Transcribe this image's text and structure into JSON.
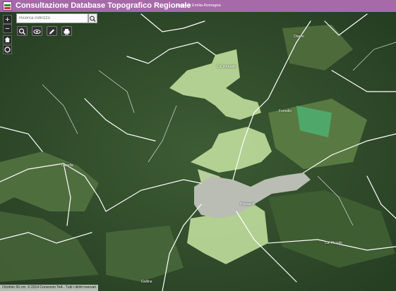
{
  "header": {
    "title": "Consultazione Database Topografico Regionale",
    "subtitle": "Regione Emilia-Romagna",
    "colors": {
      "header_bg": "#a66aa9"
    }
  },
  "search": {
    "placeholder": "Ricerca indirizzo"
  },
  "zoom": {
    "in_label": "+",
    "out_label": "−"
  },
  "toolbar": {
    "tools": [
      "search-icon",
      "eye-icon",
      "pencil-icon",
      "printer-icon"
    ]
  },
  "map": {
    "place_names": [
      "Ca' d'Aurello",
      "Fornello",
      "Casella",
      "Oserio",
      "Piopaccio",
      "Ca' Piccolo",
      "Gallina"
    ],
    "colors": {
      "highlight": "#c8e6a3",
      "road": "#ffffff"
    }
  },
  "attribution": "Ortofoto 50 cm. © 2014 Consorzio TeA - Tutti i diritti riservati"
}
